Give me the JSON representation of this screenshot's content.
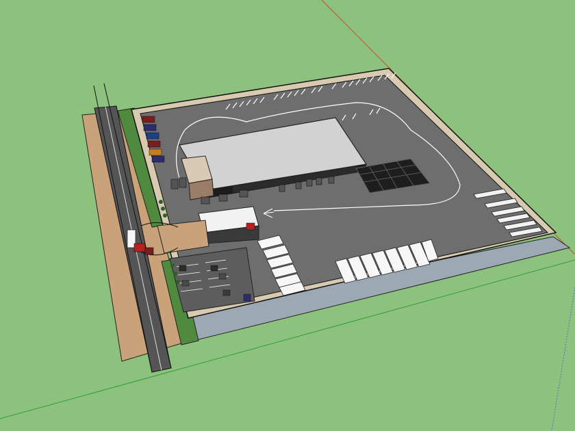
{
  "app": {
    "view": "3d-model-viewport"
  },
  "colors": {
    "ground": "#8cc17e",
    "asphalt": "#6e6e6e",
    "paving": "#686868",
    "curb": "#d8cab0",
    "dirt": "#c9a27a",
    "grass_strip": "#4f8a3e",
    "roof": "#d2d2d2",
    "building_wall": "#1c1c1c",
    "water": "#9ca8b2",
    "axis_red": "#c0502a",
    "axis_green": "#2f9e3a",
    "axis_blue": "#4f6fd0"
  }
}
